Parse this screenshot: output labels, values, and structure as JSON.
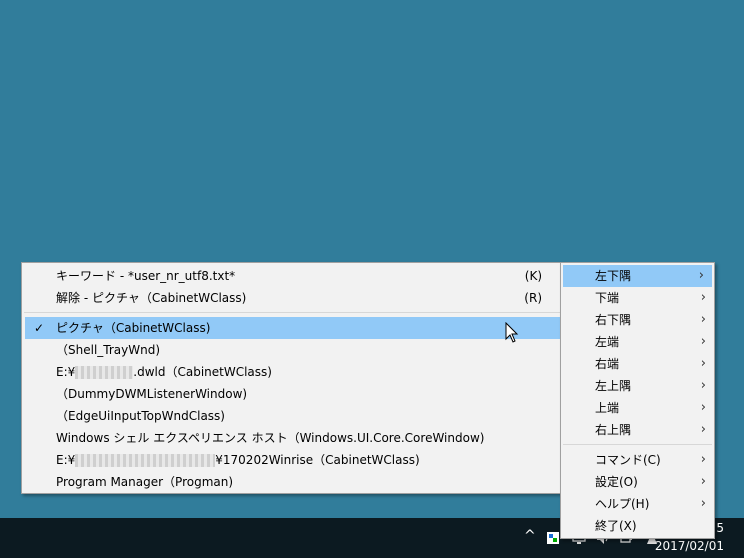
{
  "main_menu": {
    "items": [
      {
        "label": "キーワード - *user_nr_utf8.txt*",
        "accel": "(K)"
      },
      {
        "label": "解除 - ピクチャ（CabinetWClass)",
        "accel": "(R)"
      }
    ],
    "windows": [
      {
        "label": "ピクチャ（CabinetWClass)",
        "checked": true
      },
      {
        "label": "（Shell_TrayWnd)"
      },
      {
        "prefix": "E:¥",
        "suffix": ".dwld（CabinetWClass)"
      },
      {
        "label": "（DummyDWMListenerWindow)"
      },
      {
        "label": "（EdgeUiInputTopWndClass)"
      },
      {
        "label": "Windows シェル エクスペリエンス ホスト（Windows.UI.Core.CoreWindow)"
      },
      {
        "prefix": "E:¥",
        "suffix": "¥170202Winrise（CabinetWClass)"
      },
      {
        "label": "Program Manager（Progman)"
      }
    ],
    "check_glyph": "✓"
  },
  "side_menu": {
    "positions": [
      "左下隅",
      "下端",
      "右下隅",
      "左端",
      "右端",
      "左上隅",
      "上端",
      "右上隅"
    ],
    "commands": [
      "コマンド(C)",
      "設定(O)",
      "ヘルプ(H)",
      "終了(X)"
    ],
    "chevron": "›"
  },
  "taskbar": {
    "clock_time": "5",
    "clock_date": "2017/02/01",
    "tray_up_arrow": "^"
  },
  "colors": {
    "desktop": "#317d9b",
    "menu_bg": "#f2f2f2",
    "highlight": "#91c9f7",
    "taskbar": "#0c1a21"
  }
}
